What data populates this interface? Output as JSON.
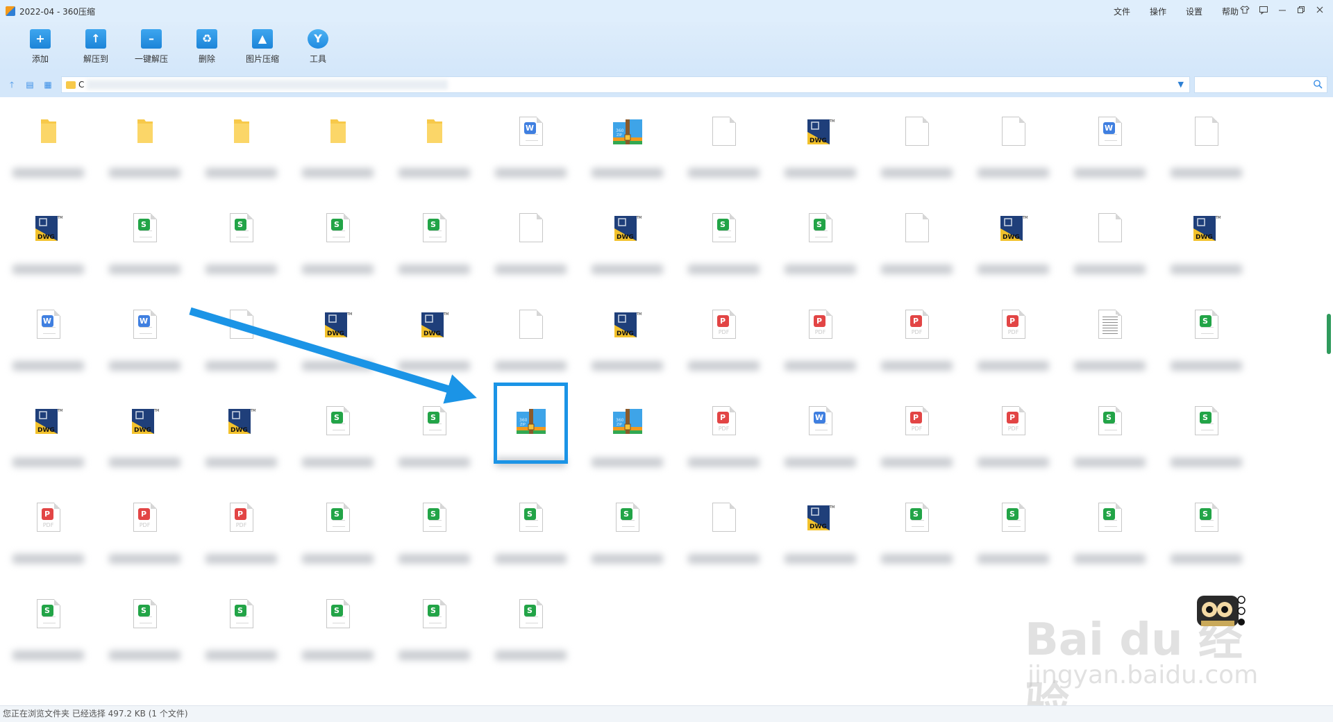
{
  "window": {
    "title": "2022-04 - 360压缩",
    "menu": [
      "文件",
      "操作",
      "设置",
      "帮助"
    ],
    "controls": [
      "skin-icon",
      "message-icon",
      "minimize-icon",
      "maximize-icon",
      "close-icon"
    ]
  },
  "toolbar": {
    "items": [
      {
        "label": "添加",
        "icon": "add-icon"
      },
      {
        "label": "解压到",
        "icon": "extract-to-icon"
      },
      {
        "label": "一键解压",
        "icon": "one-click-extract-icon"
      },
      {
        "label": "删除",
        "icon": "delete-icon"
      },
      {
        "label": "图片压缩",
        "icon": "image-compress-icon"
      },
      {
        "label": "工具",
        "icon": "tools-icon"
      }
    ]
  },
  "addressbar": {
    "path_visible": "C",
    "search_placeholder": ""
  },
  "files": {
    "rows": [
      [
        "folder",
        "folder",
        "folder",
        "folder",
        "folder",
        "word",
        "zip",
        "blank",
        "dwg",
        "blank",
        "blank",
        "word",
        "blank"
      ],
      [
        "dwg",
        "sheet",
        "sheet",
        "sheet",
        "sheet",
        "blank",
        "dwg",
        "sheet",
        "sheet",
        "blank",
        "dwg",
        "blank",
        "dwg"
      ],
      [
        "word",
        "word",
        "blank",
        "dwg",
        "dwg",
        "blank",
        "dwg",
        "pdf",
        "pdf",
        "pdf",
        "pdf",
        "text",
        "sheet"
      ],
      [
        "dwg",
        "dwg",
        "dwg",
        "sheet",
        "sheet",
        "zip",
        "zip",
        "pdf",
        "word",
        "pdf",
        "pdf",
        "sheet",
        "sheet"
      ],
      [
        "pdf",
        "pdf",
        "pdf",
        "sheet",
        "sheet",
        "sheet",
        "sheet",
        "blank",
        "dwg",
        "sheet",
        "sheet",
        "sheet",
        "sheet"
      ],
      [
        "sheet",
        "sheet",
        "sheet",
        "sheet",
        "sheet",
        "sheet"
      ]
    ],
    "selected": {
      "row": 3,
      "col": 5
    }
  },
  "colors": {
    "accent": "#1b94e6",
    "titlebar": "#dfeefc",
    "toolbar": "#d4e7fa",
    "word": "#3f7fe0",
    "sheet": "#22a447",
    "pdf": "#e24545",
    "folder": "#f7c94a"
  },
  "watermark": {
    "brand": "Bai du 经验",
    "url": "jingyan.baidu.com"
  },
  "status": {
    "text": "您正在浏览文件夹 已经选择 497.2 KB (1 个文件)"
  }
}
